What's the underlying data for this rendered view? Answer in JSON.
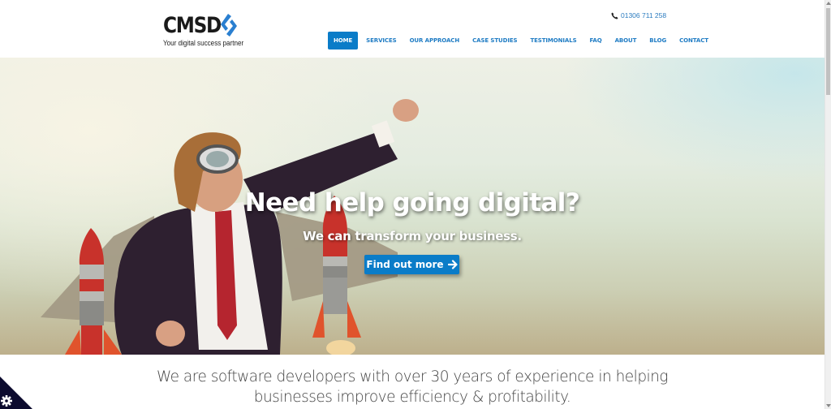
{
  "brand": {
    "name": "CMSD",
    "tagline": "Your digital success partner",
    "accent_color": "#0a7cc8",
    "logo_icon": "chevron-brackets-icon"
  },
  "header": {
    "phone_icon": "phone-icon",
    "phone": "01306 711 258",
    "nav": [
      {
        "label": "HOME",
        "active": true
      },
      {
        "label": "SERVICES",
        "active": false
      },
      {
        "label": "OUR APPROACH",
        "active": false
      },
      {
        "label": "CASE STUDIES",
        "active": false
      },
      {
        "label": "TESTIMONIALS",
        "active": false
      },
      {
        "label": "FAQ",
        "active": false
      },
      {
        "label": "ABOUT",
        "active": false
      },
      {
        "label": "BLOG",
        "active": false
      },
      {
        "label": "CONTACT",
        "active": false
      }
    ]
  },
  "hero": {
    "image_description": "Man in aviator cap and goggles wearing a suit with cardboard rocket jetpack, fist raised",
    "title": "Need help going digital?",
    "subtitle": "We can transform your business.",
    "cta_label": "Find out more",
    "cta_icon": "arrow-right-icon"
  },
  "intro": {
    "line1": "We are software developers with over 30 years of experience in helping",
    "line2": "businesses improve efficiency & profitability."
  },
  "cookie_settings": {
    "icon": "gear-icon"
  }
}
